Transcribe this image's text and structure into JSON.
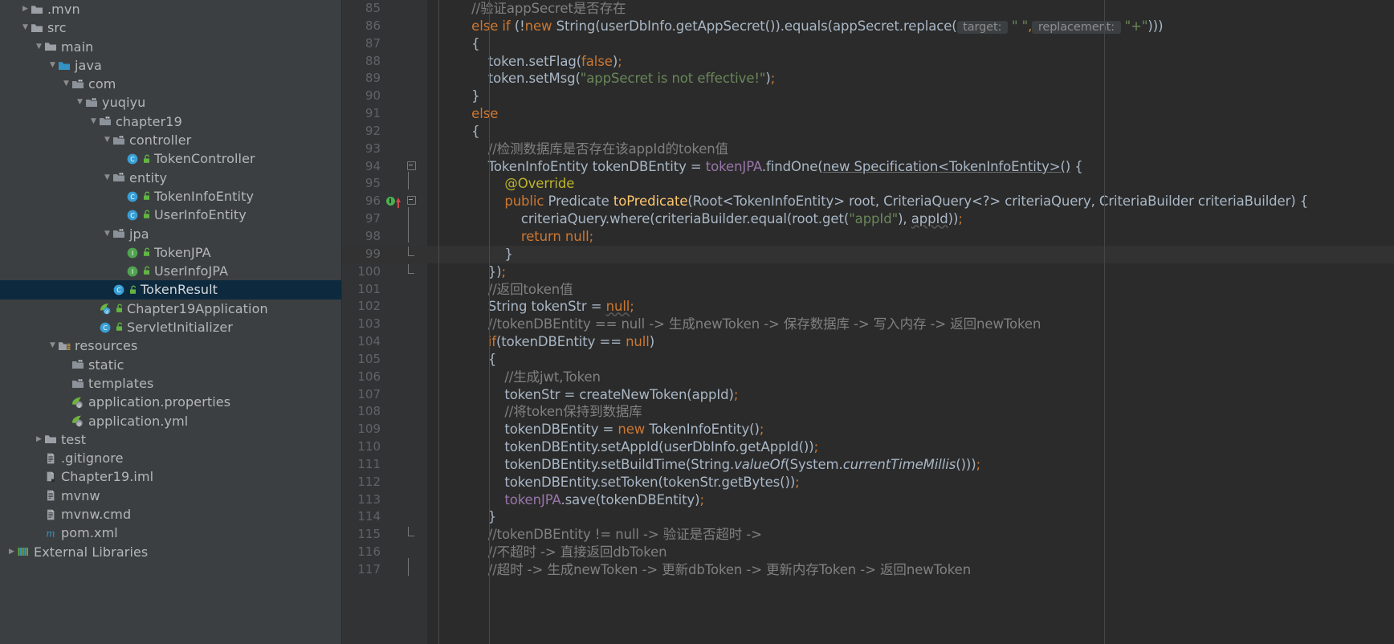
{
  "project_tree": {
    "rows": [
      {
        "indent": 1,
        "twisty": "collapsed",
        "icon": "folder-icon",
        "label": ".mvn"
      },
      {
        "indent": 1,
        "twisty": "expanded",
        "icon": "folder-icon",
        "label": "src"
      },
      {
        "indent": 2,
        "twisty": "expanded",
        "icon": "folder-icon",
        "label": "main"
      },
      {
        "indent": 3,
        "twisty": "expanded",
        "icon": "source-folder-icon",
        "label": "java"
      },
      {
        "indent": 4,
        "twisty": "expanded",
        "icon": "package-icon",
        "label": "com"
      },
      {
        "indent": 5,
        "twisty": "expanded",
        "icon": "package-icon",
        "label": "yuqiyu"
      },
      {
        "indent": 6,
        "twisty": "expanded",
        "icon": "package-icon",
        "label": "chapter19"
      },
      {
        "indent": 7,
        "twisty": "expanded",
        "icon": "package-icon",
        "label": "controller"
      },
      {
        "indent": 8,
        "twisty": "none",
        "icon": "java-class-icon",
        "label": "TokenController",
        "badge": "public-badge"
      },
      {
        "indent": 7,
        "twisty": "expanded",
        "icon": "package-icon",
        "label": "entity"
      },
      {
        "indent": 8,
        "twisty": "none",
        "icon": "java-class-icon",
        "label": "TokenInfoEntity",
        "badge": "public-badge"
      },
      {
        "indent": 8,
        "twisty": "none",
        "icon": "java-class-icon",
        "label": "UserInfoEntity",
        "badge": "public-badge"
      },
      {
        "indent": 7,
        "twisty": "expanded",
        "icon": "package-icon",
        "label": "jpa"
      },
      {
        "indent": 8,
        "twisty": "none",
        "icon": "java-interface-icon",
        "label": "TokenJPA",
        "badge": "public-badge"
      },
      {
        "indent": 8,
        "twisty": "none",
        "icon": "java-interface-icon",
        "label": "UserInfoJPA",
        "badge": "public-badge"
      },
      {
        "indent": 7,
        "twisty": "none",
        "icon": "java-class-icon",
        "label": "TokenResult",
        "badge": "public-badge",
        "selected": true
      },
      {
        "indent": 6,
        "twisty": "none",
        "icon": "spring-boot-class-icon",
        "label": "Chapter19Application",
        "badge": "public-badge"
      },
      {
        "indent": 6,
        "twisty": "none",
        "icon": "java-class-icon",
        "label": "ServletInitializer",
        "badge": "public-badge"
      },
      {
        "indent": 3,
        "twisty": "expanded",
        "icon": "resources-folder-icon",
        "label": "resources"
      },
      {
        "indent": 4,
        "twisty": "none",
        "icon": "package-icon",
        "label": "static"
      },
      {
        "indent": 4,
        "twisty": "none",
        "icon": "package-icon",
        "label": "templates"
      },
      {
        "indent": 4,
        "twisty": "none",
        "icon": "spring-config-icon",
        "label": "application.properties"
      },
      {
        "indent": 4,
        "twisty": "none",
        "icon": "spring-config-icon",
        "label": "application.yml"
      },
      {
        "indent": 2,
        "twisty": "collapsed",
        "icon": "folder-icon",
        "label": "test"
      },
      {
        "indent": 2,
        "twisty": "none",
        "icon": "file-text-icon",
        "label": ".gitignore"
      },
      {
        "indent": 2,
        "twisty": "none",
        "icon": "iml-file-icon",
        "label": "Chapter19.iml"
      },
      {
        "indent": 2,
        "twisty": "none",
        "icon": "file-text-icon",
        "label": "mvnw"
      },
      {
        "indent": 2,
        "twisty": "none",
        "icon": "file-text-icon",
        "label": "mvnw.cmd"
      },
      {
        "indent": 2,
        "twisty": "none",
        "icon": "maven-pom-icon",
        "label": "pom.xml"
      },
      {
        "indent": 0,
        "twisty": "collapsed",
        "icon": "external-libraries-icon",
        "label": "External Libraries"
      }
    ]
  },
  "editor": {
    "first_line_number": 85,
    "current_line_number": 99,
    "lines": [
      {
        "num": 85,
        "fold": "none",
        "mark": "none",
        "tokens": [
          {
            "t": "        ",
            "c": "pun"
          },
          {
            "t": "//验证appSecret是否存在",
            "c": "cmt"
          }
        ]
      },
      {
        "num": 86,
        "fold": "none",
        "mark": "none",
        "tokens": [
          {
            "t": "        ",
            "c": "pun"
          },
          {
            "t": "else",
            "c": "kw"
          },
          {
            "t": " ",
            "c": "pun"
          },
          {
            "t": "if",
            "c": "kw"
          },
          {
            "t": " (!",
            "c": "pun"
          },
          {
            "t": "new",
            "c": "kw"
          },
          {
            "t": " String(userDbInfo.getAppSecret()).equals(appSecret.replace(",
            "c": "pun"
          },
          {
            "t": " target: ",
            "c": "hint"
          },
          {
            "t": " \" \"",
            "c": "str"
          },
          {
            "t": ",",
            "c": "semi"
          },
          {
            "t": " replacement: ",
            "c": "hint"
          },
          {
            "t": " \"+\"",
            "c": "str"
          },
          {
            "t": ")))",
            "c": "pun"
          }
        ]
      },
      {
        "num": 87,
        "fold": "none",
        "mark": "none",
        "tokens": [
          {
            "t": "        {",
            "c": "pun"
          }
        ]
      },
      {
        "num": 88,
        "fold": "none",
        "mark": "none",
        "tokens": [
          {
            "t": "            token.setFlag(",
            "c": "pun"
          },
          {
            "t": "false",
            "c": "kw"
          },
          {
            "t": ")",
            "c": "pun"
          },
          {
            "t": ";",
            "c": "semi"
          }
        ]
      },
      {
        "num": 89,
        "fold": "none",
        "mark": "none",
        "tokens": [
          {
            "t": "            token.setMsg(",
            "c": "pun"
          },
          {
            "t": "\"appSecret is not effective!\"",
            "c": "str"
          },
          {
            "t": ")",
            "c": "pun"
          },
          {
            "t": ";",
            "c": "semi"
          }
        ]
      },
      {
        "num": 90,
        "fold": "none",
        "mark": "none",
        "tokens": [
          {
            "t": "        }",
            "c": "pun"
          }
        ]
      },
      {
        "num": 91,
        "fold": "none",
        "mark": "none",
        "tokens": [
          {
            "t": "        ",
            "c": "pun"
          },
          {
            "t": "else",
            "c": "kw"
          }
        ]
      },
      {
        "num": 92,
        "fold": "none",
        "mark": "none",
        "tokens": [
          {
            "t": "        {",
            "c": "pun"
          }
        ]
      },
      {
        "num": 93,
        "fold": "none",
        "mark": "none",
        "tokens": [
          {
            "t": "            ",
            "c": "pun"
          },
          {
            "t": "//检测数据库是否存在该appId的token值",
            "c": "cmt"
          }
        ]
      },
      {
        "num": 94,
        "fold": "start",
        "mark": "none",
        "tokens": [
          {
            "t": "            TokenInfoEntity tokenDBEntity = ",
            "c": "pun"
          },
          {
            "t": "tokenJPA",
            "c": "fld"
          },
          {
            "t": ".findOne(",
            "c": "pun"
          },
          {
            "t": "new Specification<TokenInfoEntity>()",
            "c": "uline"
          },
          {
            "t": " {",
            "c": "pun"
          }
        ]
      },
      {
        "num": 95,
        "fold": "line",
        "mark": "none",
        "tokens": [
          {
            "t": "                ",
            "c": "pun"
          },
          {
            "t": "@Override",
            "c": "anno"
          }
        ]
      },
      {
        "num": 96,
        "fold": "start",
        "mark": "bulb-and-arrow",
        "tokens": [
          {
            "t": "                ",
            "c": "pun"
          },
          {
            "t": "public",
            "c": "kw"
          },
          {
            "t": " Predicate ",
            "c": "pun"
          },
          {
            "t": "toPredicate",
            "c": "mth"
          },
          {
            "t": "(Root<TokenInfoEntity> root, CriteriaQuery<?> criteriaQuery, CriteriaBuilder criteriaBuilder) {",
            "c": "pun"
          }
        ]
      },
      {
        "num": 97,
        "fold": "line",
        "mark": "none",
        "tokens": [
          {
            "t": "                    criteriaQuery.where(criteriaBuilder.equal(root.get(",
            "c": "pun"
          },
          {
            "t": "\"appId\"",
            "c": "str"
          },
          {
            "t": "), ",
            "c": "pun"
          },
          {
            "t": "appId",
            "c": "wavy"
          },
          {
            "t": "))",
            "c": "pun"
          },
          {
            "t": ";",
            "c": "semi"
          }
        ]
      },
      {
        "num": 98,
        "fold": "line",
        "mark": "none",
        "tokens": [
          {
            "t": "                    ",
            "c": "pun"
          },
          {
            "t": "return null",
            "c": "kw"
          },
          {
            "t": ";",
            "c": "semi"
          }
        ]
      },
      {
        "num": 99,
        "fold": "end",
        "mark": "none",
        "tokens": [
          {
            "t": "                }",
            "c": "pun"
          }
        ]
      },
      {
        "num": 100,
        "fold": "end",
        "mark": "none",
        "tokens": [
          {
            "t": "            })",
            "c": "pun"
          },
          {
            "t": ";",
            "c": "semi"
          }
        ]
      },
      {
        "num": 101,
        "fold": "none",
        "mark": "none",
        "tokens": [
          {
            "t": "            ",
            "c": "pun"
          },
          {
            "t": "//返回token值",
            "c": "cmt"
          }
        ]
      },
      {
        "num": 102,
        "fold": "none",
        "mark": "none",
        "tokens": [
          {
            "t": "            String tokenStr = ",
            "c": "pun"
          },
          {
            "t": "null",
            "c": "kw wavy"
          },
          {
            "t": ";",
            "c": "semi"
          }
        ]
      },
      {
        "num": 103,
        "fold": "none",
        "mark": "none",
        "tokens": [
          {
            "t": "            ",
            "c": "pun"
          },
          {
            "t": "//tokenDBEntity == null -> 生成newToken -> 保存数据库 -> 写入内存 -> 返回newToken",
            "c": "cmt"
          }
        ]
      },
      {
        "num": 104,
        "fold": "none",
        "mark": "none",
        "tokens": [
          {
            "t": "            ",
            "c": "pun"
          },
          {
            "t": "if",
            "c": "kw"
          },
          {
            "t": "(tokenDBEntity == ",
            "c": "pun"
          },
          {
            "t": "null",
            "c": "kw"
          },
          {
            "t": ")",
            "c": "pun"
          }
        ]
      },
      {
        "num": 105,
        "fold": "none",
        "mark": "none",
        "tokens": [
          {
            "t": "            {",
            "c": "pun"
          }
        ]
      },
      {
        "num": 106,
        "fold": "none",
        "mark": "none",
        "tokens": [
          {
            "t": "                ",
            "c": "pun"
          },
          {
            "t": "//生成jwt,Token",
            "c": "cmt"
          }
        ]
      },
      {
        "num": 107,
        "fold": "none",
        "mark": "none",
        "tokens": [
          {
            "t": "                tokenStr = createNewToken(appId)",
            "c": "pun"
          },
          {
            "t": ";",
            "c": "semi"
          }
        ]
      },
      {
        "num": 108,
        "fold": "none",
        "mark": "none",
        "tokens": [
          {
            "t": "                ",
            "c": "pun"
          },
          {
            "t": "//将token保持到数据库",
            "c": "cmt"
          }
        ]
      },
      {
        "num": 109,
        "fold": "none",
        "mark": "none",
        "tokens": [
          {
            "t": "                tokenDBEntity = ",
            "c": "pun"
          },
          {
            "t": "new",
            "c": "kw"
          },
          {
            "t": " TokenInfoEntity()",
            "c": "pun"
          },
          {
            "t": ";",
            "c": "semi"
          }
        ]
      },
      {
        "num": 110,
        "fold": "none",
        "mark": "none",
        "tokens": [
          {
            "t": "                tokenDBEntity.setAppId(userDbInfo.getAppId())",
            "c": "pun"
          },
          {
            "t": ";",
            "c": "semi"
          }
        ]
      },
      {
        "num": 111,
        "fold": "none",
        "mark": "none",
        "tokens": [
          {
            "t": "                tokenDBEntity.setBuildTime(String.",
            "c": "pun"
          },
          {
            "t": "valueOf",
            "c": "ital"
          },
          {
            "t": "(System.",
            "c": "pun"
          },
          {
            "t": "currentTimeMillis",
            "c": "ital"
          },
          {
            "t": "()))",
            "c": "pun"
          },
          {
            "t": ";",
            "c": "semi"
          }
        ]
      },
      {
        "num": 112,
        "fold": "none",
        "mark": "none",
        "tokens": [
          {
            "t": "                tokenDBEntity.setToken(tokenStr.getBytes())",
            "c": "pun"
          },
          {
            "t": ";",
            "c": "semi"
          }
        ]
      },
      {
        "num": 113,
        "fold": "none",
        "mark": "none",
        "tokens": [
          {
            "t": "                ",
            "c": "pun"
          },
          {
            "t": "tokenJPA",
            "c": "fld"
          },
          {
            "t": ".save(tokenDBEntity)",
            "c": "pun"
          },
          {
            "t": ";",
            "c": "semi"
          }
        ]
      },
      {
        "num": 114,
        "fold": "none",
        "mark": "none",
        "tokens": [
          {
            "t": "            }",
            "c": "pun"
          }
        ]
      },
      {
        "num": 115,
        "fold": "end",
        "mark": "none",
        "tokens": [
          {
            "t": "            ",
            "c": "pun"
          },
          {
            "t": "//tokenDBEntity != null -> 验证是否超时 ->",
            "c": "cmt"
          }
        ]
      },
      {
        "num": 116,
        "fold": "none",
        "mark": "none",
        "tokens": [
          {
            "t": "            ",
            "c": "pun"
          },
          {
            "t": "//不超时 -> 直接返回dbToken",
            "c": "cmt"
          }
        ]
      },
      {
        "num": 117,
        "fold": "line",
        "mark": "none",
        "tokens": [
          {
            "t": "            ",
            "c": "pun"
          },
          {
            "t": "//超时 -> 生成newToken -> 更新dbToken -> 更新内存Token -> 返回newToken",
            "c": "cmt"
          }
        ]
      }
    ]
  },
  "colors": {
    "editor_bg": "#2b2b2b",
    "gutter_bg": "#313335",
    "panel_bg": "#3c3f41",
    "selection_bg": "#0d293e",
    "keyword": "#cc7832",
    "comment": "#808080",
    "string": "#6a8759",
    "number": "#6897bb",
    "field": "#9876aa",
    "method": "#ffc66d",
    "annotation": "#bbb529",
    "default_text": "#a9b7c6",
    "line_number": "#606366"
  }
}
